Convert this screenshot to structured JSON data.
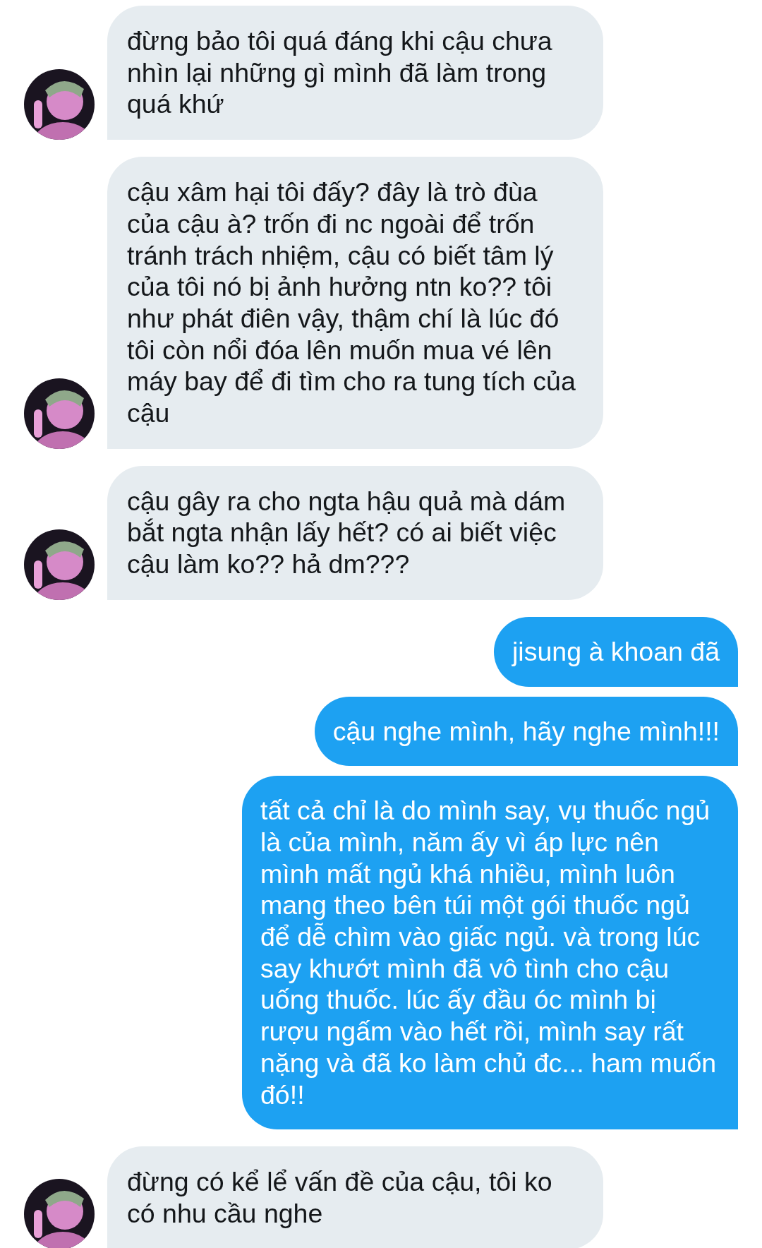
{
  "messages": [
    {
      "kind": "received",
      "text": "đừng bảo tôi quá đáng khi cậu chưa nhìn lại những gì mình đã làm trong quá khứ"
    },
    {
      "kind": "received",
      "text": "cậu xâm hại tôi đấy? đây là trò đùa của cậu à? trốn đi nc ngoài để trốn tránh trách nhiệm, cậu có biết tâm lý của tôi nó bị ảnh hưởng ntn ko?? tôi như phát điên vậy, thậm chí là lúc đó tôi còn nổi đóa lên muốn mua vé lên máy bay để đi tìm cho ra tung tích của cậu"
    },
    {
      "kind": "received",
      "text": "cậu gây ra cho ngta hậu quả mà dám bắt ngta nhận lấy hết? có ai biết việc cậu làm ko?? hả dm???"
    },
    {
      "kind": "sent",
      "text": "jisung à khoan đã"
    },
    {
      "kind": "sent",
      "text": "cậu nghe mình, hãy nghe mình!!!"
    },
    {
      "kind": "sent",
      "text": "tất cả chỉ là do mình say, vụ thuốc ngủ là của mình, năm ấy vì áp lực nên mình mất ngủ khá nhiều, mình luôn mang theo bên túi một gói thuốc ngủ để dễ chìm vào giấc ngủ. và trong lúc say khướt mình đã vô tình cho cậu uống thuốc. lúc ấy đầu óc mình bị rượu ngấm vào hết rồi, mình say rất nặng và đã ko làm chủ đc... ham muốn đó!!"
    },
    {
      "kind": "received",
      "text": "đừng có kể lể vấn đề của cậu, tôi ko có nhu cầu nghe"
    }
  ]
}
